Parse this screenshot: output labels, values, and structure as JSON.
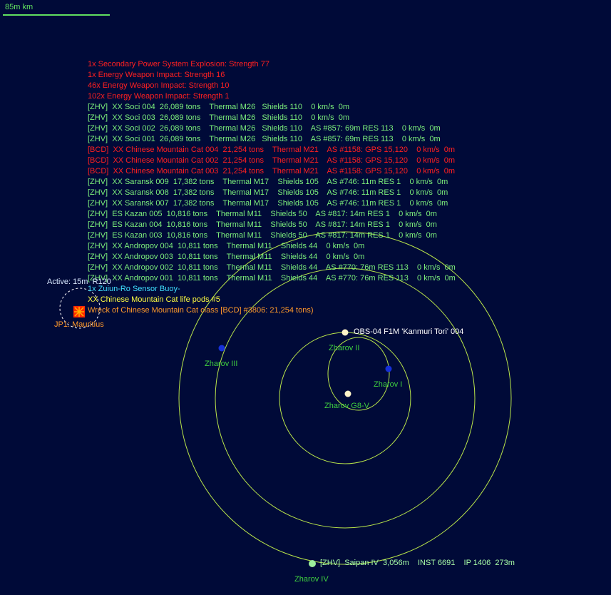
{
  "scale": {
    "label": "85m km"
  },
  "colors": {
    "background": "#000a38",
    "orbit": "#b8e64a",
    "planet_blue": "#1630d8",
    "star": "#fff4c8",
    "text_red": "#ff2020",
    "text_green": "#7cf07c",
    "text_cyan": "#3fe0ff",
    "text_yellow": "#ffff40",
    "text_orange": "#ff9a2a",
    "body_label": "#3fd03f"
  },
  "events": [
    "1x Secondary Power System Explosion: Strength 77",
    "1x Energy Weapon Impact: Strength 16",
    "46x Energy Weapon Impact: Strength 10",
    "102x Energy Weapon Impact: Strength 1"
  ],
  "contacts": [
    {
      "text": "[ZHV]  XX Soci 004  26,089 tons    Thermal M26   Shields 110    0 km/s  0m",
      "hostile": false
    },
    {
      "text": "[ZHV]  XX Soci 003  26,089 tons    Thermal M26   Shields 110    0 km/s  0m",
      "hostile": false
    },
    {
      "text": "[ZHV]  XX Soci 002  26,089 tons    Thermal M26   Shields 110    AS #857: 69m RES 113    0 km/s  0m",
      "hostile": false
    },
    {
      "text": "[ZHV]  XX Soci 001  26,089 tons    Thermal M26   Shields 110    AS #857: 69m RES 113    0 km/s  0m",
      "hostile": false
    },
    {
      "text": "[BCD]  XX Chinese Mountain Cat 004  21,254 tons    Thermal M21    AS #1158: GPS 15,120    0 km/s  0m",
      "hostile": true
    },
    {
      "text": "[BCD]  XX Chinese Mountain Cat 002  21,254 tons    Thermal M21    AS #1158: GPS 15,120    0 km/s  0m",
      "hostile": true
    },
    {
      "text": "[BCD]  XX Chinese Mountain Cat 003  21,254 tons    Thermal M21    AS #1158: GPS 15,120    0 km/s  0m",
      "hostile": true
    },
    {
      "text": "[ZHV]  XX Saransk 009  17,382 tons    Thermal M17    Shields 105    AS #746: 11m RES 1    0 km/s  0m",
      "hostile": false
    },
    {
      "text": "[ZHV]  XX Saransk 008  17,382 tons    Thermal M17    Shields 105    AS #746: 11m RES 1    0 km/s  0m",
      "hostile": false
    },
    {
      "text": "[ZHV]  XX Saransk 007  17,382 tons    Thermal M17    Shields 105    AS #746: 11m RES 1    0 km/s  0m",
      "hostile": false
    },
    {
      "text": "[ZHV]  ES Kazan 005  10,816 tons    Thermal M11    Shields 50    AS #817: 14m RES 1    0 km/s  0m",
      "hostile": false
    },
    {
      "text": "[ZHV]  ES Kazan 004  10,816 tons    Thermal M11    Shields 50    AS #817: 14m RES 1    0 km/s  0m",
      "hostile": false
    },
    {
      "text": "[ZHV]  ES Kazan 003  10,816 tons    Thermal M11    Shields 50    AS #817: 14m RES 1    0 km/s  0m",
      "hostile": false
    },
    {
      "text": "[ZHV]  XX Andropov 004  10,811 tons    Thermal M11    Shields 44    0 km/s  0m",
      "hostile": false
    },
    {
      "text": "[ZHV]  XX Andropov 003  10,811 tons    Thermal M11    Shields 44    0 km/s  0m",
      "hostile": false
    },
    {
      "text": "[ZHV]  XX Andropov 002  10,811 tons    Thermal M11    Shields 44    AS #770: 76m RES 113    0 km/s  0m",
      "hostile": false
    },
    {
      "text": "[ZHV]  XX Andropov 001  10,811 tons    Thermal M11    Shields 44    AS #770: 76m RES 113    0 km/s  0m",
      "hostile": false
    }
  ],
  "sensor_buoy": "1x Zuiun-Ro Sensor Buoy-",
  "life_pods": "XX Chinese Mountain Cat life pods #5",
  "wreck": "Wreck of Chinese Mountain Cat class [BCD] #3806: 21,254 tons)",
  "active_sensor": "Active: 15m  R120",
  "jump_point": "JP1: Mauritius",
  "bodies": {
    "star": "Zharov G8-V",
    "zharov_i": "Zharov I",
    "zharov_ii": "Zharov II",
    "zharov_iii": "Zharov III",
    "zharov_iv": "Zharov IV"
  },
  "obs_label": "OBS-04 F1M 'Kanmuri Tori' 004",
  "saipan_label": "[ZHV]  Saipan IV  3,056m    INST 6691    IP 1406  273m"
}
